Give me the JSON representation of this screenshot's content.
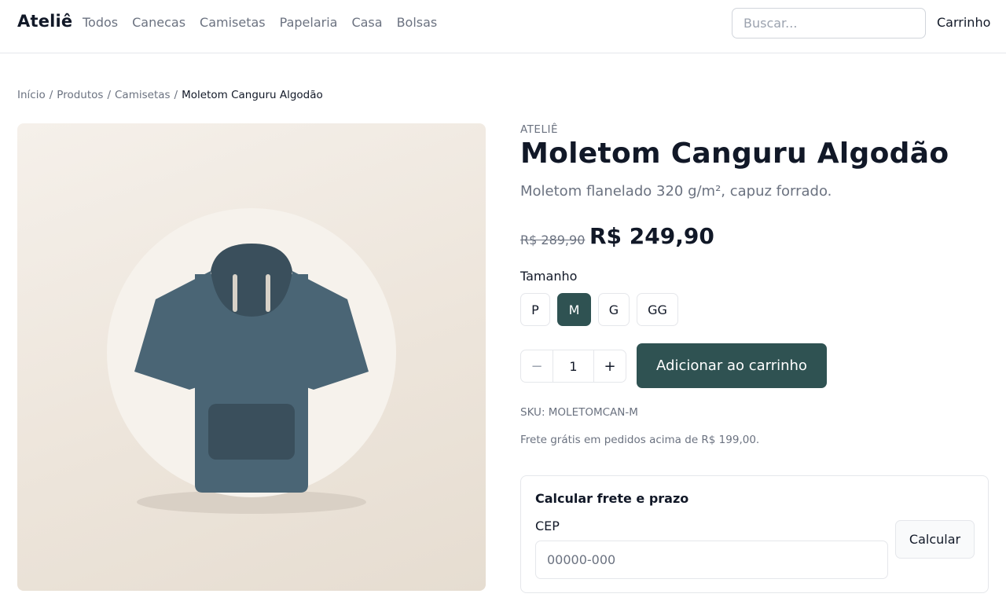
{
  "header": {
    "brand": "Ateliê",
    "nav": [
      "Todos",
      "Canecas",
      "Camisetas",
      "Papelaria",
      "Casa",
      "Bolsas"
    ],
    "search_placeholder": "Buscar...",
    "cart_label": "Carrinho"
  },
  "breadcrumb": {
    "items": [
      "Início",
      "Produtos",
      "Camisetas"
    ],
    "separator": "/",
    "current": "Moletom Canguru Algodão"
  },
  "product": {
    "brand": "ATELIÊ",
    "title": "Moletom Canguru Algodão",
    "subtitle": "Moletom flanelado 320 g/m², capuz forrado.",
    "old_price": "R$ 289,90",
    "price": "R$ 249,90",
    "size_label": "Tamanho",
    "sizes": [
      "P",
      "M",
      "G",
      "GG"
    ],
    "selected_size": "M",
    "quantity": "1",
    "minus_symbol": "−",
    "plus_symbol": "+",
    "add_to_cart": "Adicionar ao carrinho",
    "sku": "SKU: MOLETOMCAN-M",
    "shipping_note": "Frete grátis em pedidos acima de R$ 199,00.",
    "image_icon": "hoodie-illustration",
    "colors": {
      "accent": "#2f5252",
      "hoodie": "#4a6575",
      "hoodie_dark": "#3a4f5c"
    }
  },
  "shipping_calc": {
    "title": "Calcular frete e prazo",
    "cep_label": "CEP",
    "cep_placeholder": "00000-000",
    "button": "Calcular"
  }
}
